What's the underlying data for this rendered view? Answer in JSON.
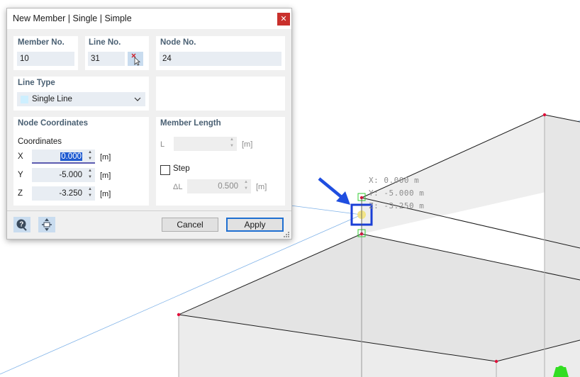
{
  "dialog": {
    "title": "New Member | Single | Simple",
    "close_icon": "close-icon",
    "member_no": {
      "label": "Member No.",
      "value": "10"
    },
    "line_no": {
      "label": "Line No.",
      "value": "31",
      "pick_icon": "pick-cursor-icon"
    },
    "node_no": {
      "label": "Node No.",
      "value": "24"
    },
    "line_type": {
      "label": "Line Type",
      "value": "Single Line",
      "dropdown_icon": "chevron-down-icon"
    },
    "node_coordinates": {
      "label": "Node Coordinates",
      "sublabel": "Coordinates",
      "x": {
        "label": "X",
        "value": "0.000",
        "unit": "[m]"
      },
      "y": {
        "label": "Y",
        "value": "-5.000",
        "unit": "[m]"
      },
      "z": {
        "label": "Z",
        "value": "-3.250",
        "unit": "[m]"
      }
    },
    "member_length": {
      "label": "Member Length",
      "l_label": "L",
      "l_value": "",
      "l_unit": "[m]",
      "step_label": "Step",
      "delta_label": "ΔL",
      "delta_value": "0.500",
      "delta_unit": "[m]"
    },
    "footer": {
      "help_icon": "help-icon",
      "snap_icon": "snap-node-icon",
      "cancel_label": "Cancel",
      "apply_label": "Apply"
    }
  },
  "viewport": {
    "coord_readout": [
      "X: 0.000 m",
      "Y: -5.000 m",
      "Z: -3.250 m"
    ],
    "colors": {
      "node": "#e0103a",
      "selection": "#1a3fd6",
      "arrow": "#1f4ee0",
      "axis_line": "#7fb2e8",
      "support": "#33dd22"
    }
  }
}
